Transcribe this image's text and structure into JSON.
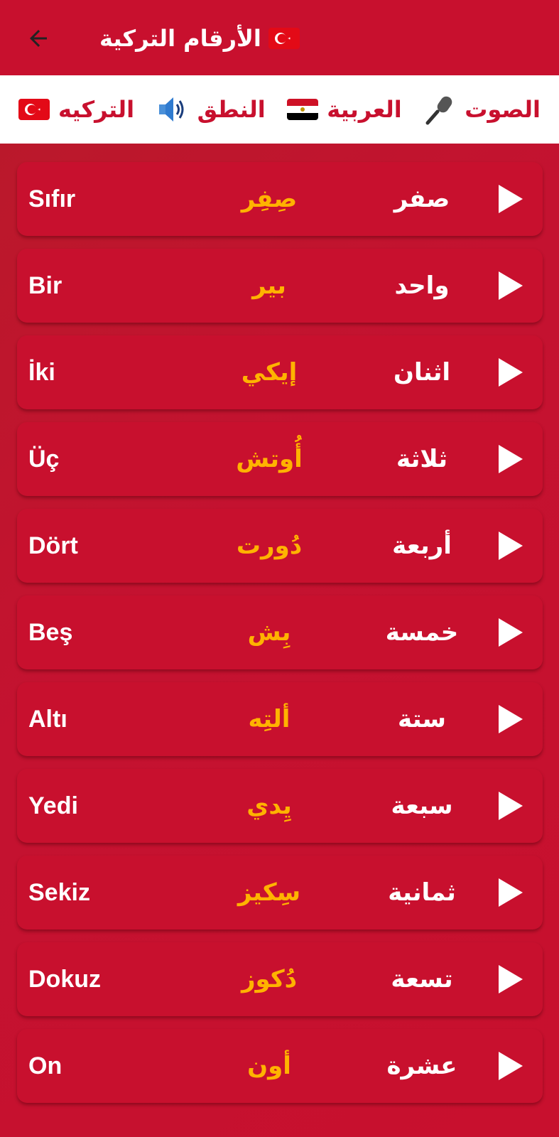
{
  "appbar": {
    "title": "الأرقام التركية",
    "flag_icon": "turkey-flag-icon"
  },
  "legend": [
    {
      "label": "الصوت",
      "icon": "microphone-icon"
    },
    {
      "label": "العربية",
      "icon": "egypt-flag-icon"
    },
    {
      "label": "النطق",
      "icon": "speaker-icon"
    },
    {
      "label": "التركيه",
      "icon": "turkey-flag-icon"
    }
  ],
  "rows": [
    {
      "arabic": "صفر",
      "pron": "صِفِر",
      "turkish": "Sıfır"
    },
    {
      "arabic": "واحد",
      "pron": "بير",
      "turkish": "Bir"
    },
    {
      "arabic": "اثنان",
      "pron": "إيكي",
      "turkish": "İki"
    },
    {
      "arabic": "ثلاثة",
      "pron": "أُوتش",
      "turkish": "Üç"
    },
    {
      "arabic": "أربعة",
      "pron": "دُورت",
      "turkish": "Dört"
    },
    {
      "arabic": "خمسة",
      "pron": "بِش",
      "turkish": "Beş"
    },
    {
      "arabic": "ستة",
      "pron": "ألتِه",
      "turkish": "Altı"
    },
    {
      "arabic": "سبعة",
      "pron": "يِدي",
      "turkish": "Yedi"
    },
    {
      "arabic": "ثمانية",
      "pron": "سِكيز",
      "turkish": "Sekiz"
    },
    {
      "arabic": "تسعة",
      "pron": "دُكوز",
      "turkish": "Dokuz"
    },
    {
      "arabic": "عشرة",
      "pron": "أون",
      "turkish": "On"
    }
  ],
  "colors": {
    "primary": "#c8102e",
    "accent": "#ffb300",
    "text": "#ffffff"
  }
}
